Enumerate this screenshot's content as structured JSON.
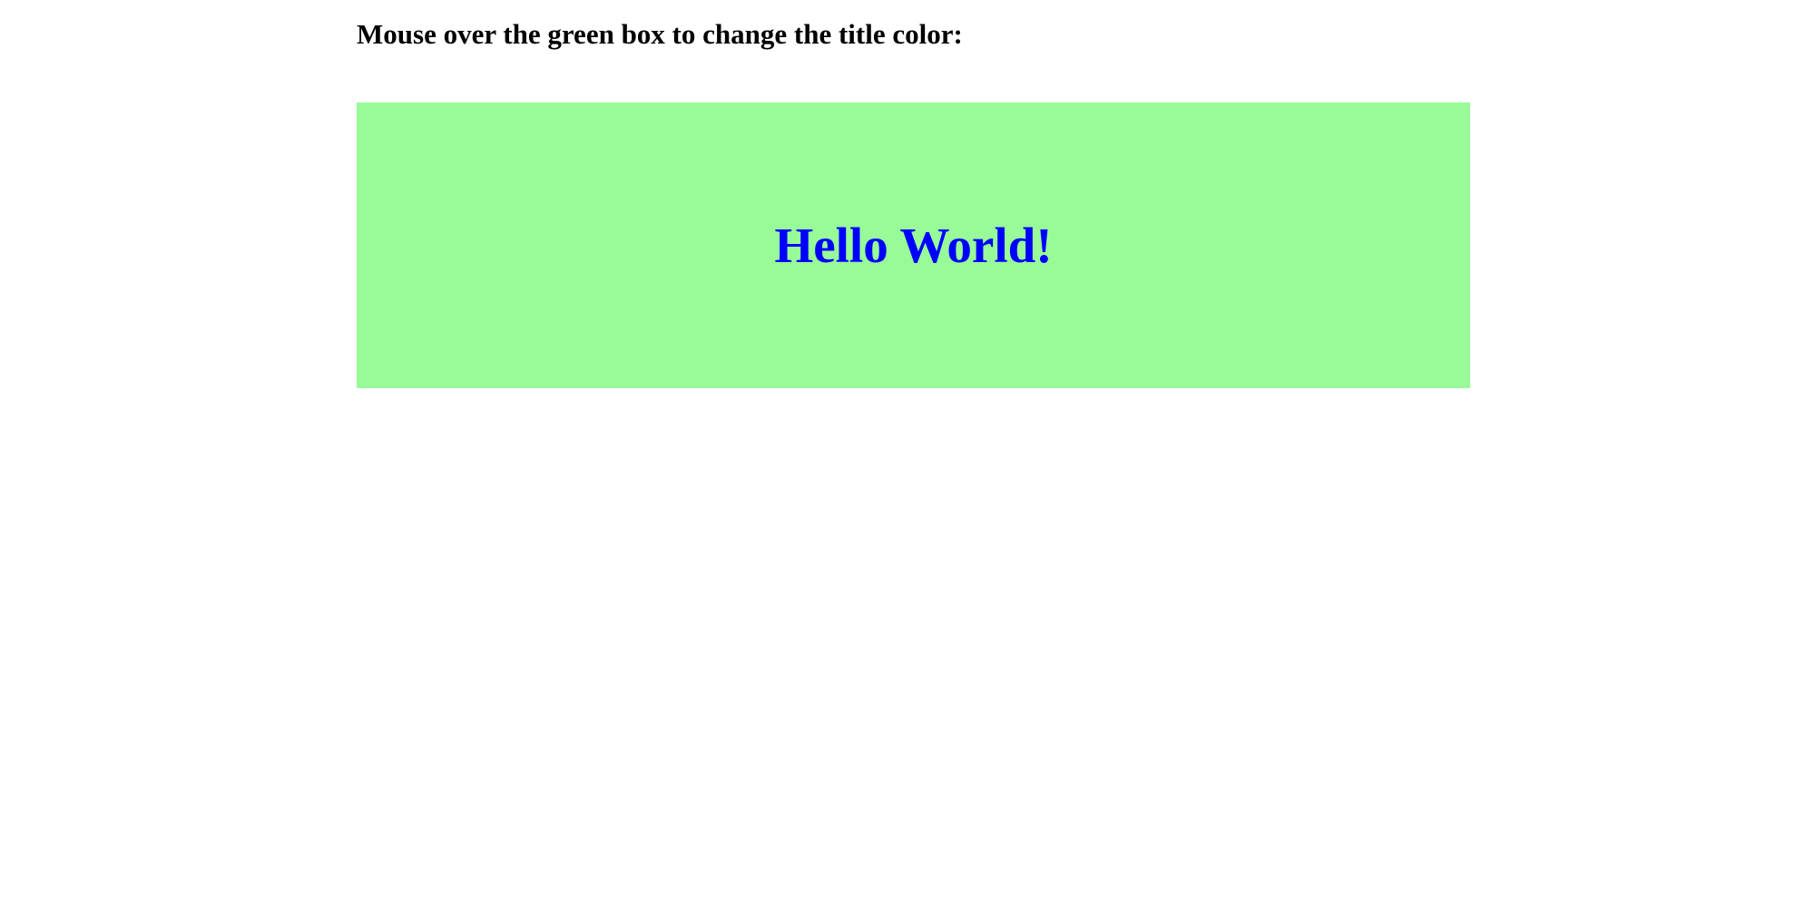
{
  "instruction": {
    "text": "Mouse over the green box to change the title color:"
  },
  "box": {
    "title": "Hello World!",
    "background_color": "#98fb98",
    "title_color": "#0000ff"
  }
}
